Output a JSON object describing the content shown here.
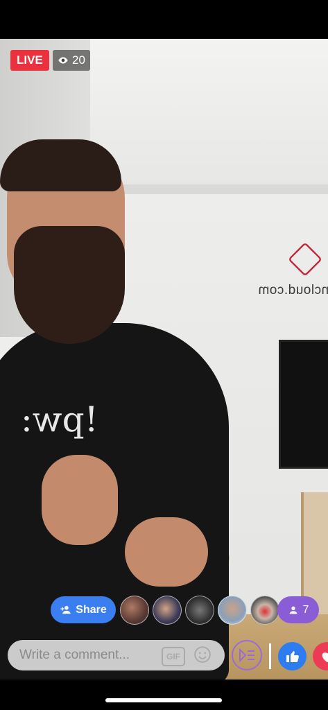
{
  "live": {
    "label": "LIVE",
    "viewer_count": "20",
    "eye_icon": "eye-icon"
  },
  "scene": {
    "shirt_text": "!pw:",
    "wall_text": "ncloud.com"
  },
  "actions": {
    "share_label": "Share",
    "friends_count": "7"
  },
  "avatars": [
    "avatar-1",
    "avatar-2",
    "avatar-3",
    "avatar-4",
    "avatar-5"
  ],
  "comment": {
    "placeholder": "Write a comment...",
    "gif_label": "GIF"
  },
  "colors": {
    "live": "#e9323d",
    "share": "#3b7ef0",
    "friends": "#8a5cd6",
    "like": "#2d7cf2",
    "love": "#ee3b55"
  }
}
